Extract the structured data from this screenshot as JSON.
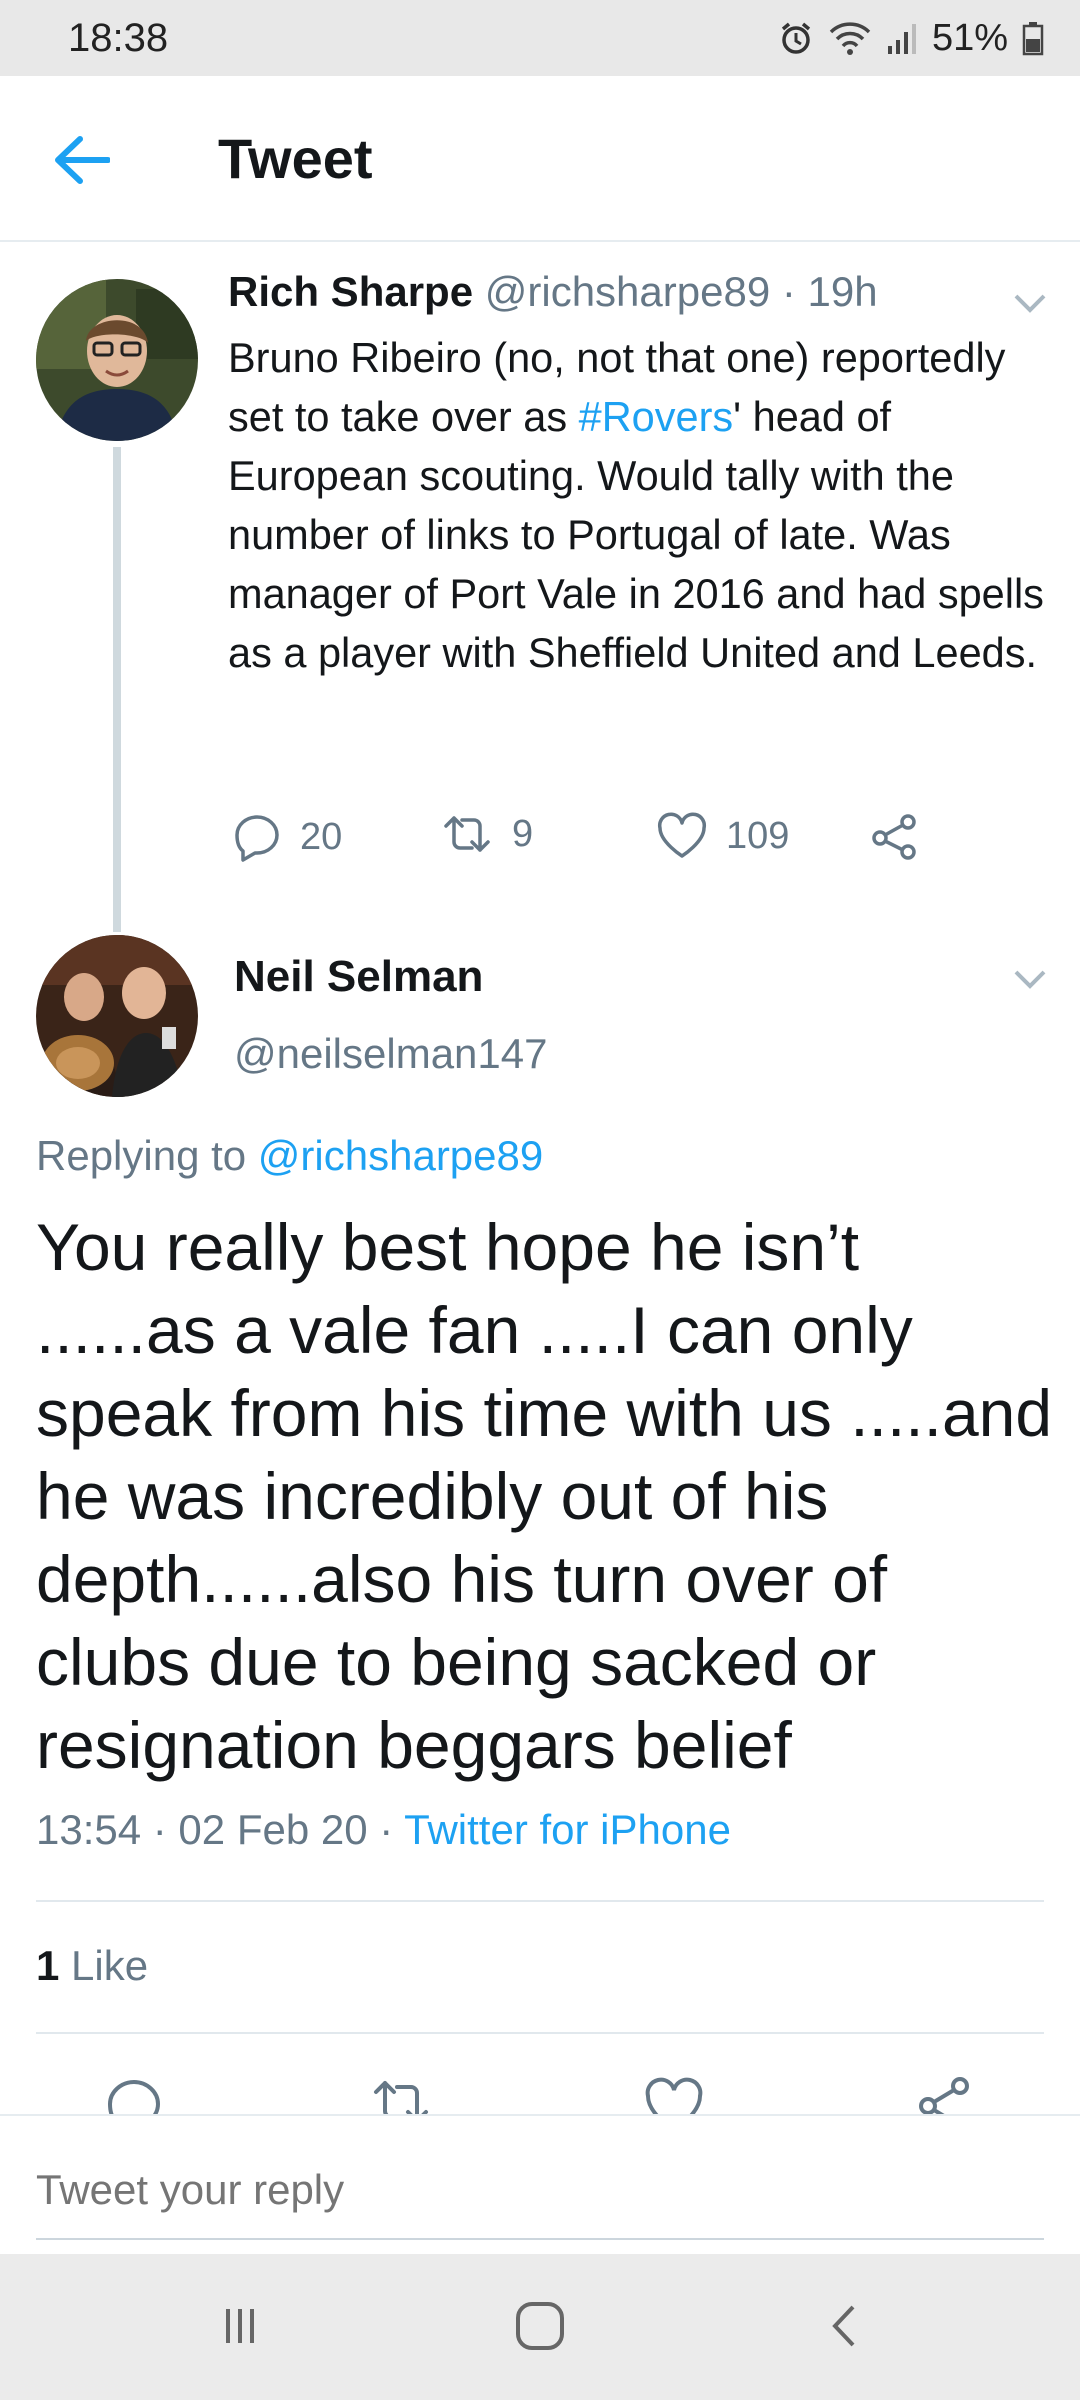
{
  "status_bar": {
    "time": "18:38",
    "battery": "51%",
    "icons": [
      "alarm-icon",
      "wifi-icon",
      "signal-icon",
      "battery-icon"
    ]
  },
  "header": {
    "title": "Tweet",
    "back_icon": "back-arrow-icon"
  },
  "tweet1": {
    "name": "Rich Sharpe",
    "handle": "@richsharpe89",
    "time": "· 19h",
    "text_before": "Bruno Ribeiro (no, not that one) reportedly set to take over as ",
    "hashtag": "#Rovers",
    "text_after": "' head of European scouting. Would tally with the number of links to Portugal of late. Was manager of Port Vale in 2016 and had spells as a player with Sheffield United and Leeds.",
    "actions": {
      "replies": "20",
      "retweets": "9",
      "likes": "109"
    }
  },
  "tweet2": {
    "name": "Neil Selman",
    "handle": "@neilselman147",
    "replying_prefix": "Replying to ",
    "replying_handle": "@richsharpe89",
    "text": "You really best hope he isn’t ......as a vale fan .....I can only speak from his time with us .....and he was incredibly out of his depth......also his turn over of clubs due to being sacked or resignation beggars belief",
    "timestamp": "13:54 · 02 Feb 20 · ",
    "source": "Twitter for iPhone",
    "like_count": "1",
    "like_label": " Like"
  },
  "reply_bar": {
    "placeholder": "Tweet your reply"
  },
  "colors": {
    "accent": "#1da1f2",
    "secondary_text": "#657786",
    "primary_text": "#14171a",
    "divider": "#e1e8ed"
  }
}
